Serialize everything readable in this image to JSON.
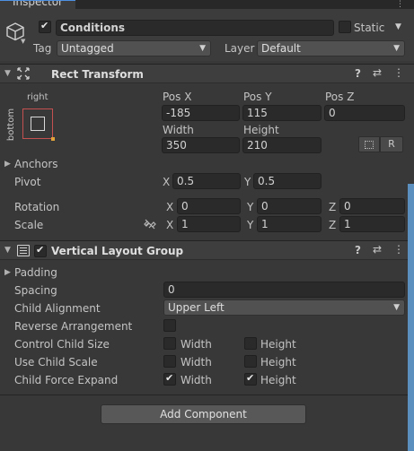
{
  "tab": {
    "title": "Inspector"
  },
  "gameobject": {
    "name": "Conditions",
    "active": true,
    "static_label": "Static",
    "tag_label": "Tag",
    "tag_value": "Untagged",
    "layer_label": "Layer",
    "layer_value": "Default"
  },
  "rect_transform": {
    "title": "Rect Transform",
    "anchor_h": "right",
    "anchor_v": "bottom",
    "pos_x_label": "Pos X",
    "pos_y_label": "Pos Y",
    "pos_z_label": "Pos Z",
    "pos_x": "-185",
    "pos_y": "115",
    "pos_z": "0",
    "width_label": "Width",
    "height_label": "Height",
    "width": "350",
    "height": "210",
    "r_button": "R",
    "anchors_label": "Anchors",
    "pivot_label": "Pivot",
    "pivot_x_label": "X",
    "pivot_x": "0.5",
    "pivot_y_label": "Y",
    "pivot_y": "0.5",
    "rotation_label": "Rotation",
    "rot_x": "0",
    "rot_y": "0",
    "rot_z": "0",
    "scale_label": "Scale",
    "scale_x": "1",
    "scale_y": "1",
    "scale_z": "1",
    "x": "X",
    "y": "Y",
    "z": "Z"
  },
  "vlg": {
    "title": "Vertical Layout Group",
    "enabled": true,
    "padding_label": "Padding",
    "spacing_label": "Spacing",
    "spacing": "0",
    "child_alignment_label": "Child Alignment",
    "child_alignment": "Upper Left",
    "reverse_label": "Reverse Arrangement",
    "reverse": false,
    "control_size_label": "Control Child Size",
    "use_scale_label": "Use Child Scale",
    "force_expand_label": "Child Force Expand",
    "width_label": "Width",
    "height_label": "Height",
    "control_width": false,
    "control_height": false,
    "scale_width": false,
    "scale_height": false,
    "expand_width": true,
    "expand_height": true
  },
  "add_component": {
    "label": "Add Component"
  },
  "icons": {
    "cube": "cube-icon",
    "rect": "rect-transform-icon",
    "layout": "layout-group-icon",
    "help": "help-icon",
    "preset": "preset-icon",
    "menu": "kebab-menu-icon",
    "link": "link-icon",
    "blueprint": "blueprint-icon"
  },
  "colors": {
    "panel": "#383838",
    "field": "#2a2a2a",
    "accent": "#4b90e2",
    "anchor_box": "#c45050"
  }
}
